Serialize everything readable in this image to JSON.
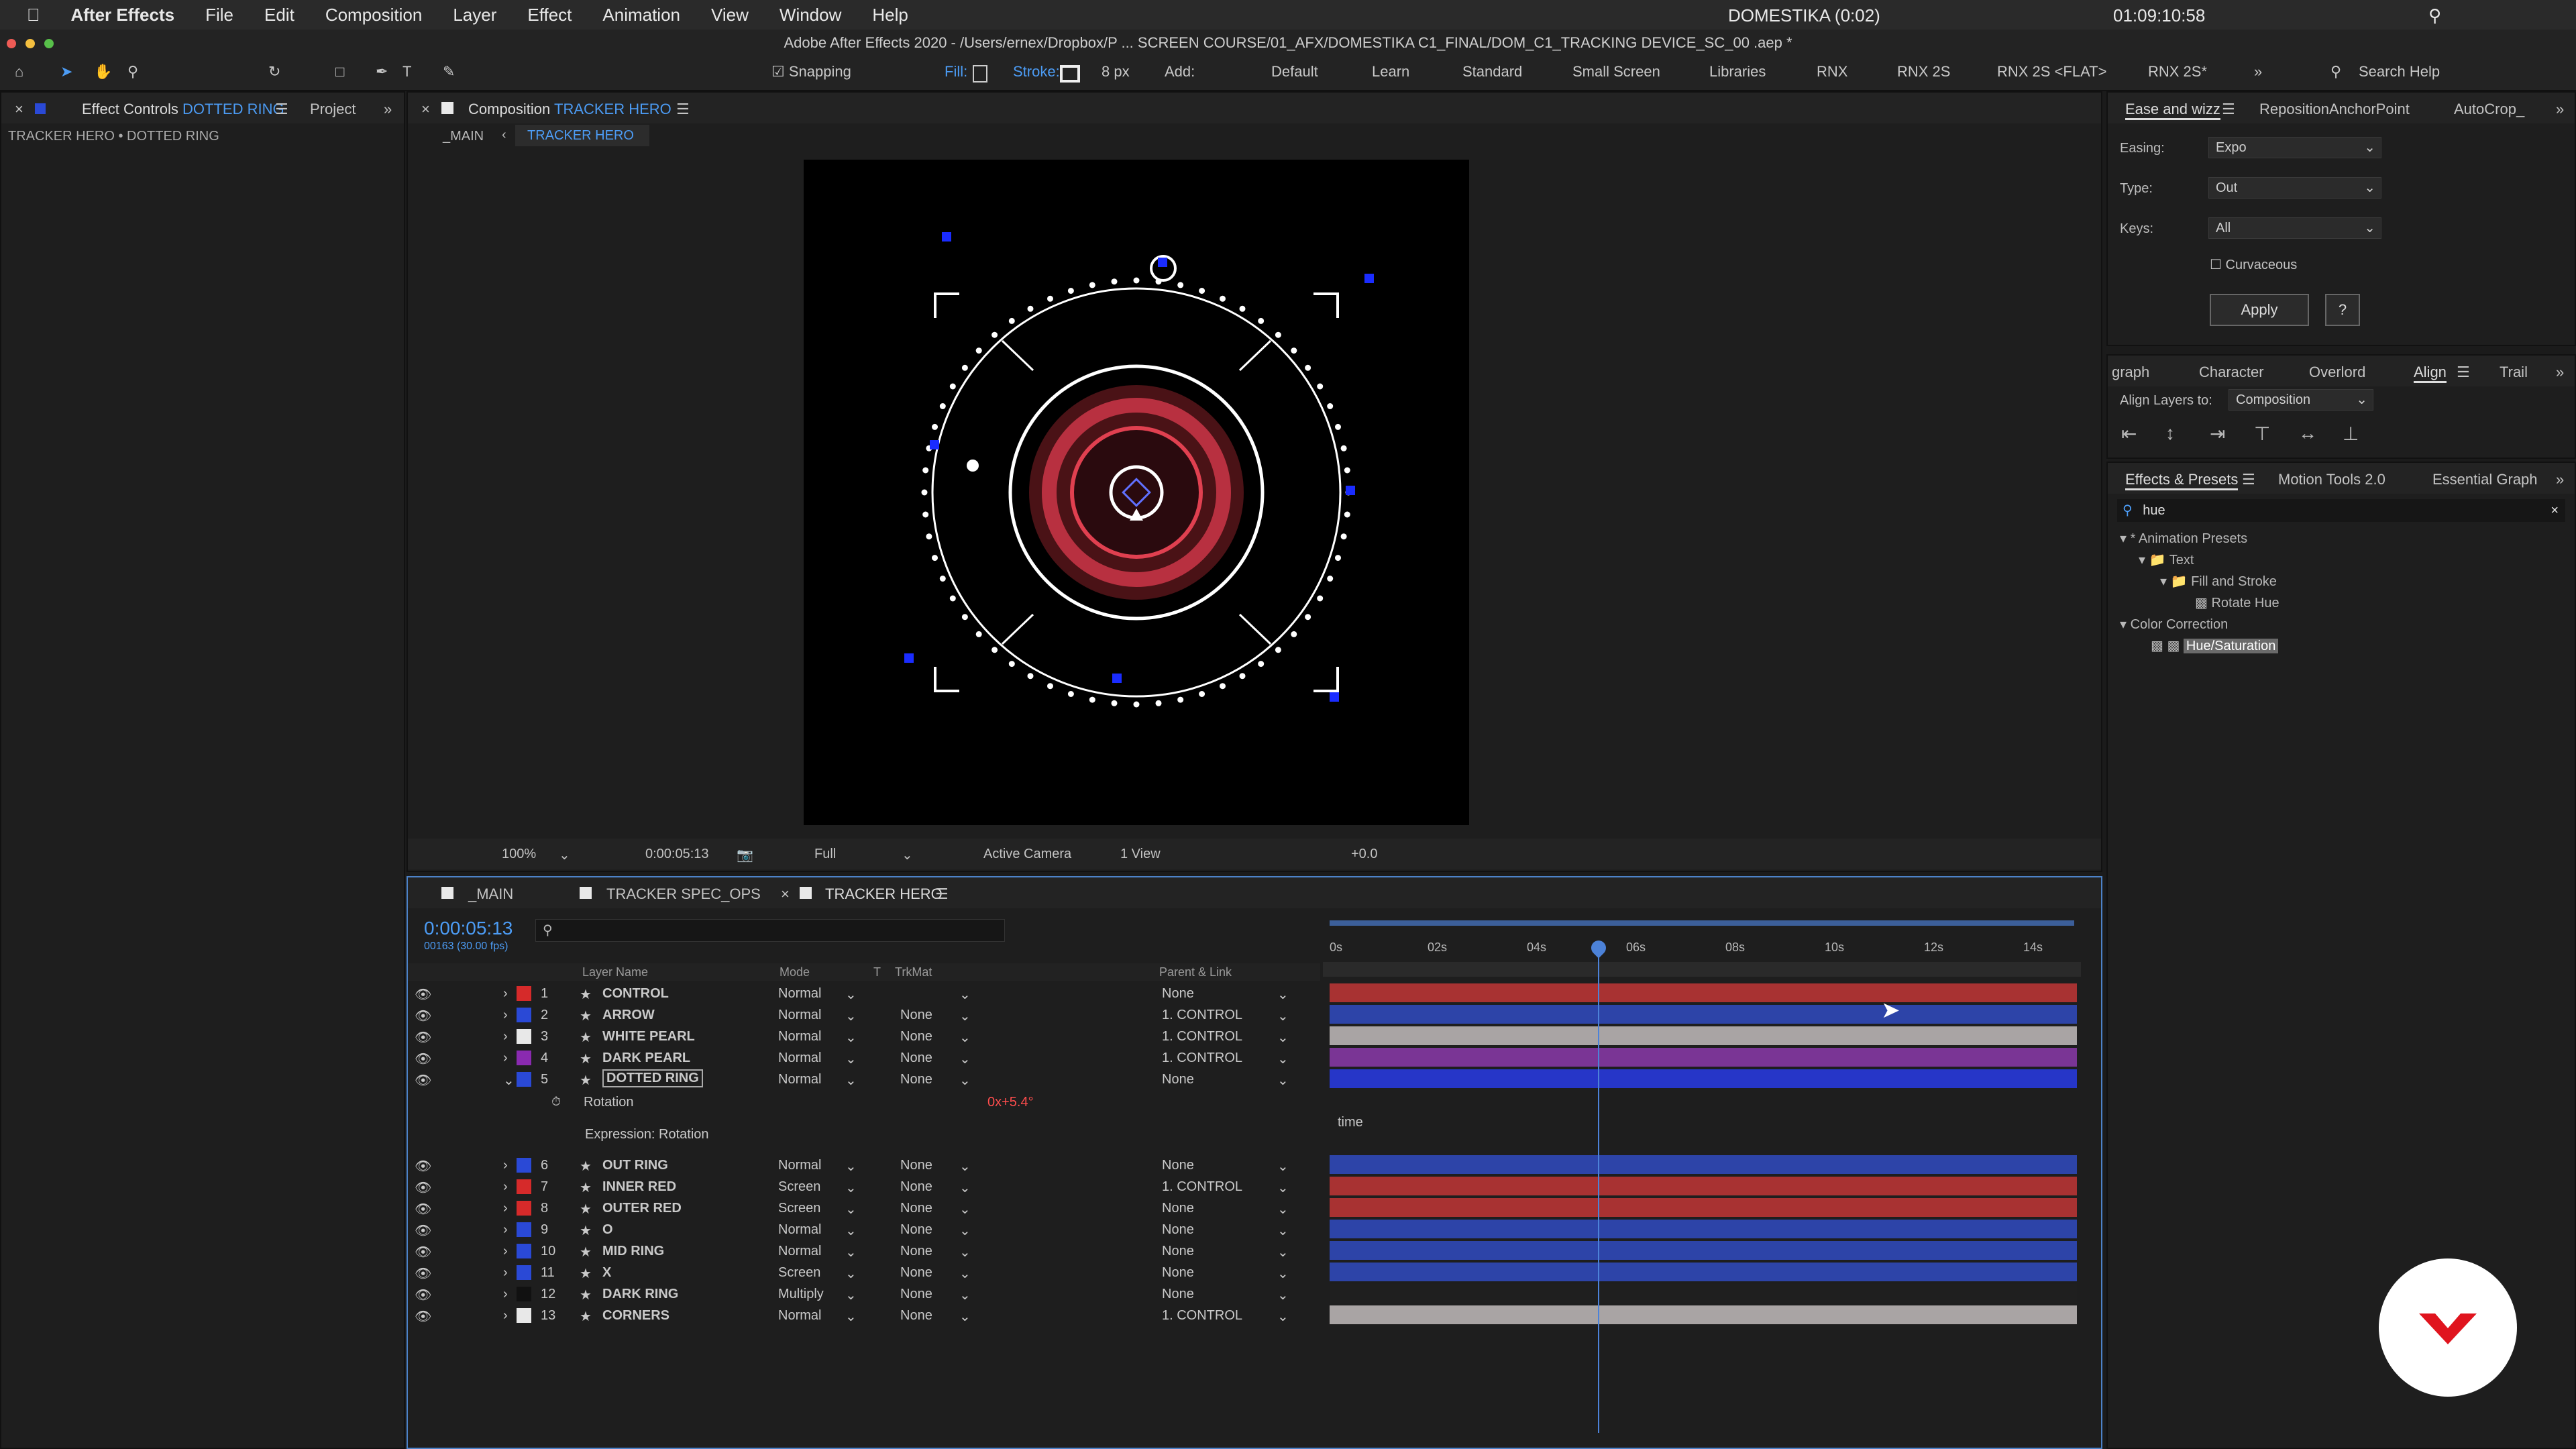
{
  "menubar": {
    "app": "After Effects",
    "items": [
      "File",
      "Edit",
      "Composition",
      "Layer",
      "Effect",
      "Animation",
      "View",
      "Window",
      "Help"
    ],
    "status": {
      "domestika": "DOMESTIKA (0:02)",
      "clock": "01:09:10:58"
    }
  },
  "window_title": "Adobe After Effects 2020 - /Users/ernex/Dropbox/P ... SCREEN COURSE/01_AFX/DOMESTIKA C1_FINAL/DOM_C1_TRACKING DEVICE_SC_00 .aep *",
  "toolbar": {
    "snapping": "Snapping",
    "fill": "Fill:",
    "stroke": "Stroke:",
    "stroke_px": "8 px",
    "add": "Add:",
    "workspaces": [
      "Default",
      "Learn",
      "Standard",
      "Small Screen",
      "Libraries",
      "RNX",
      "RNX 2S",
      "RNX 2S <FLAT>",
      "RNX 2S*"
    ],
    "search": "Search Help"
  },
  "left_panel": {
    "tab_effect": "Effect Controls",
    "tab_effect_layer": "DOTTED RING",
    "tab_project": "Project",
    "breadcrumb": "TRACKER HERO • DOTTED RING"
  },
  "comp_panel": {
    "title": "Composition",
    "title_name": "TRACKER HERO",
    "nav_main": "_MAIN",
    "nav_tracker": "TRACKER HERO",
    "zoom": "100%",
    "time": "0:00:05:13",
    "quality": "Full",
    "camera": "Active Camera",
    "view": "1 View",
    "exposure": "+0.0"
  },
  "timeline": {
    "tabs": [
      "_MAIN",
      "TRACKER SPEC_OPS",
      "TRACKER HERO"
    ],
    "timecode": "0:00:05:13",
    "fps": "00163 (30.00 fps)",
    "cols": {
      "layer_name": "Layer Name",
      "mode": "Mode",
      "t": "T",
      "trkmat": "TrkMat",
      "parent": "Parent & Link"
    },
    "ruler": [
      "0s",
      "02s",
      "04s",
      "06s",
      "08s",
      "10s",
      "12s",
      "14s"
    ],
    "layers": [
      {
        "num": "1",
        "name": "CONTROL",
        "mode": "Normal",
        "trkmat": "",
        "parent": "None",
        "color": "#d62a2a",
        "bar": "#a83232"
      },
      {
        "num": "2",
        "name": "ARROW",
        "mode": "Normal",
        "trkmat": "None",
        "parent": "1. CONTROL",
        "color": "#2a49d6",
        "bar": "#2d44a8"
      },
      {
        "num": "3",
        "name": "WHITE PEARL",
        "mode": "Normal",
        "trkmat": "None",
        "parent": "1. CONTROL",
        "color": "#e8e8e8",
        "bar": "#a9a4a4"
      },
      {
        "num": "4",
        "name": "DARK PEARL",
        "mode": "Normal",
        "trkmat": "None",
        "parent": "1. CONTROL",
        "color": "#8a2ab0",
        "bar": "#7a3595"
      },
      {
        "num": "5",
        "name": "DOTTED RING",
        "mode": "Normal",
        "trkmat": "None",
        "parent": "None",
        "color": "#2a49d6",
        "bar": "#2636c8"
      }
    ],
    "rotation": {
      "label": "Rotation",
      "value": "0x+5.4°",
      "expr_label": "Expression: Rotation",
      "expr": "time"
    },
    "layers2": [
      {
        "num": "6",
        "name": "OUT RING",
        "mode": "Normal",
        "trkmat": "None",
        "parent": "None",
        "color": "#2a49d6",
        "bar": "#2d44a8"
      },
      {
        "num": "7",
        "name": "INNER RED",
        "mode": "Screen",
        "trkmat": "None",
        "parent": "1. CONTROL",
        "color": "#d62a2a",
        "bar": "#a83232"
      },
      {
        "num": "8",
        "name": "OUTER RED",
        "mode": "Screen",
        "trkmat": "None",
        "parent": "None",
        "color": "#d62a2a",
        "bar": "#a83232"
      },
      {
        "num": "9",
        "name": "O",
        "mode": "Normal",
        "trkmat": "None",
        "parent": "None",
        "color": "#2a49d6",
        "bar": "#2d44a8"
      },
      {
        "num": "10",
        "name": "MID RING",
        "mode": "Normal",
        "trkmat": "None",
        "parent": "None",
        "color": "#2a49d6",
        "bar": "#2d44a8"
      },
      {
        "num": "11",
        "name": "X",
        "mode": "Screen",
        "trkmat": "None",
        "parent": "None",
        "color": "#2a49d6",
        "bar": "#2d44a8"
      },
      {
        "num": "12",
        "name": "DARK RING",
        "mode": "Multiply",
        "trkmat": "None",
        "parent": "None",
        "color": "#111111",
        "bar": "#1f1f1f"
      },
      {
        "num": "13",
        "name": "CORNERS",
        "mode": "Normal",
        "trkmat": "None",
        "parent": "1. CONTROL",
        "color": "#e8e8e8",
        "bar": "#a9a4a4"
      }
    ]
  },
  "ease_panel": {
    "tabs": [
      "Ease and wizz",
      "RepositionAnchorPoint",
      "AutoCrop_"
    ],
    "easing_label": "Easing:",
    "easing": "Expo",
    "type_label": "Type:",
    "type": "Out",
    "keys_label": "Keys:",
    "keys": "All",
    "curvaceous": "Curvaceous",
    "apply": "Apply",
    "help": "?"
  },
  "align_panel": {
    "tabs": [
      "graph",
      "Character",
      "Overlord",
      "Align",
      "Trail"
    ],
    "align_to_label": "Align Layers to:",
    "align_to": "Composition"
  },
  "effects_panel": {
    "tabs": [
      "Effects & Presets",
      "Motion Tools 2.0",
      "Essential Graph"
    ],
    "search": "hue",
    "tree": [
      "* Animation Presets",
      "Text",
      "Fill and Stroke",
      "Rotate Hue",
      "Color Correction",
      "Hue/Saturation"
    ]
  }
}
